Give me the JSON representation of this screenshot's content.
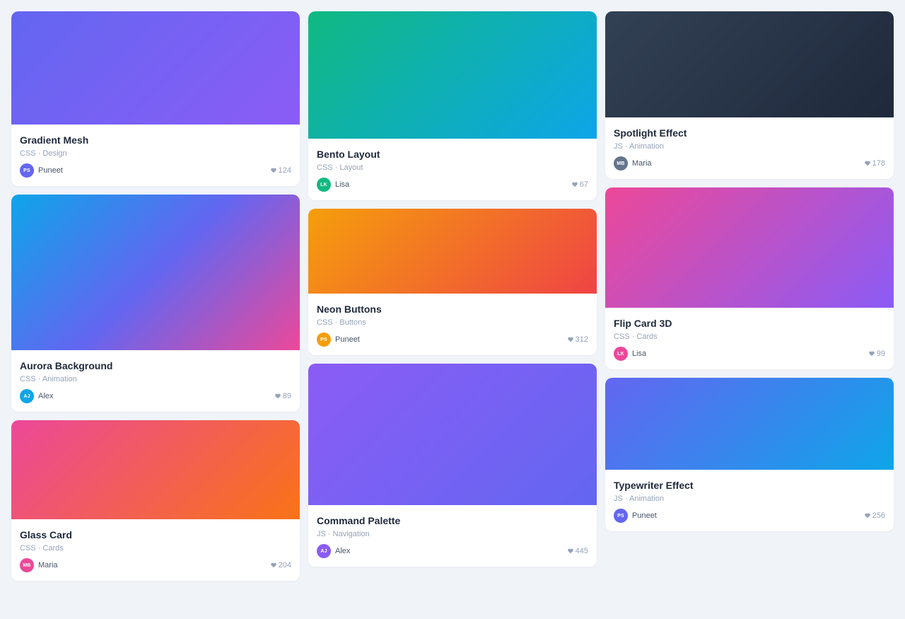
{
  "columns": [
    [
      {
        "title": "Gradient Mesh",
        "lang": "CSS",
        "category": "Design",
        "initials": "PS",
        "author": "Puneet",
        "likes": "124",
        "avatar_color": "#6366f1",
        "gradient": [
          "#6366f1",
          "#8b5cf6"
        ]
      },
      {
        "title": "Aurora Background",
        "lang": "CSS",
        "category": "Animation",
        "initials": "AJ",
        "author": "Alex",
        "likes": "89",
        "avatar_color": "#0ea5e9",
        "gradient": [
          "#0ea5e9",
          "#6366f1",
          "#ec4899"
        ]
      },
      {
        "title": "Glass Card",
        "lang": "CSS",
        "category": "Cards",
        "initials": "MB",
        "author": "Maria",
        "likes": "204",
        "avatar_color": "#ec4899",
        "gradient": [
          "#ec4899",
          "#f97316"
        ]
      }
    ],
    [
      {
        "title": "Bento Layout",
        "lang": "CSS",
        "category": "Layout",
        "initials": "LK",
        "author": "Lisa",
        "likes": "67",
        "avatar_color": "#10b981",
        "gradient": [
          "#10b981",
          "#0ea5e9"
        ]
      },
      {
        "title": "Neon Buttons",
        "lang": "CSS",
        "category": "Buttons",
        "initials": "PS",
        "author": "Puneet",
        "likes": "312",
        "avatar_color": "#f59e0b",
        "gradient": [
          "#f59e0b",
          "#ef4444"
        ]
      },
      {
        "title": "Command Palette",
        "lang": "JS",
        "category": "Navigation",
        "initials": "AJ",
        "author": "Alex",
        "likes": "445",
        "avatar_color": "#8b5cf6",
        "gradient": [
          "#8b5cf6",
          "#6366f1"
        ]
      }
    ],
    [
      {
        "title": "Spotlight Effect",
        "lang": "JS",
        "category": "Animation",
        "initials": "MB",
        "author": "Maria",
        "likes": "178",
        "avatar_color": "#64748b",
        "gradient": [
          "#334155",
          "#1e293b"
        ]
      },
      {
        "title": "Flip Card 3D",
        "lang": "CSS",
        "category": "Cards",
        "initials": "LK",
        "author": "Lisa",
        "likes": "99",
        "avatar_color": "#ec4899",
        "gradient": [
          "#ec4899",
          "#8b5cf6"
        ]
      },
      {
        "title": "Typewriter Effect",
        "lang": "JS",
        "category": "Animation",
        "initials": "PS",
        "author": "Puneet",
        "likes": "256",
        "avatar_color": "#6366f1",
        "gradient": [
          "#6366f1",
          "#0ea5e9"
        ]
      }
    ]
  ],
  "separator": "·",
  "icons": {
    "like": "heart-icon"
  }
}
